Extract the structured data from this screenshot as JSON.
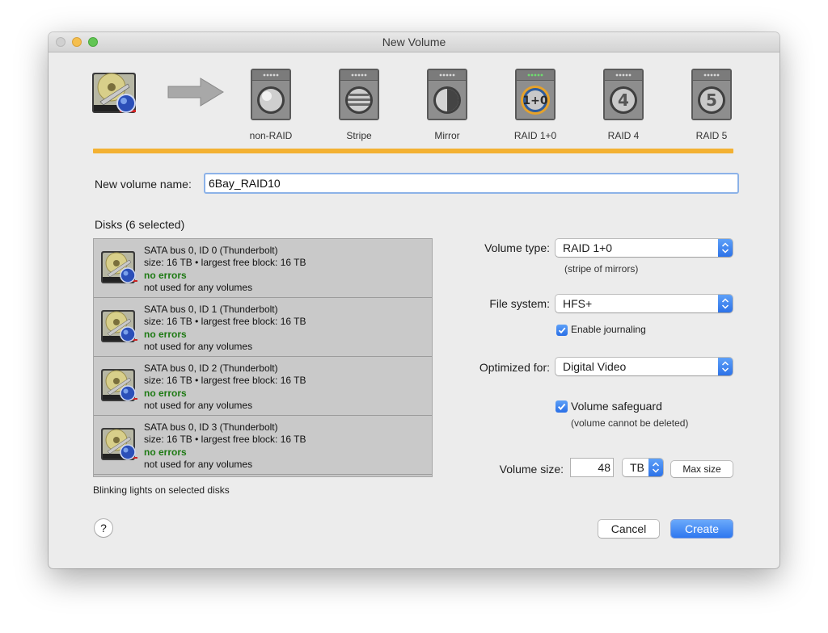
{
  "window": {
    "title": "New Volume"
  },
  "raid_options": [
    {
      "label": "non-RAID",
      "icon": "sphere-plain"
    },
    {
      "label": "Stripe",
      "icon": "sphere-striped"
    },
    {
      "label": "Mirror",
      "icon": "sphere-half"
    },
    {
      "label": "RAID 1+0",
      "icon": "sphere-1+0",
      "glyph": "1+0",
      "selected": true
    },
    {
      "label": "RAID 4",
      "icon": "sphere-4",
      "glyph": "4"
    },
    {
      "label": "RAID 5",
      "icon": "sphere-5",
      "glyph": "5"
    }
  ],
  "volume_name": {
    "label": "New volume name:",
    "value": "6Bay_RAID10"
  },
  "disks": {
    "header": "Disks (6 selected)",
    "rows": [
      {
        "title": "SATA bus 0, ID 0 (Thunderbolt)",
        "size": "size: 16 TB • largest free block: 16 TB",
        "status": "no errors",
        "usage": "not used for any volumes"
      },
      {
        "title": "SATA bus 0, ID 1 (Thunderbolt)",
        "size": "size: 16 TB • largest free block: 16 TB",
        "status": "no errors",
        "usage": "not used for any volumes"
      },
      {
        "title": "SATA bus 0, ID 2 (Thunderbolt)",
        "size": "size: 16 TB • largest free block: 16 TB",
        "status": "no errors",
        "usage": "not used for any volumes"
      },
      {
        "title": "SATA bus 0, ID 3 (Thunderbolt)",
        "size": "size: 16 TB • largest free block: 16 TB",
        "status": "no errors",
        "usage": "not used for any volumes"
      }
    ],
    "footer": "Blinking lights on selected disks"
  },
  "volume_type": {
    "label": "Volume type:",
    "value": "RAID 1+0",
    "note": "(stripe of mirrors)"
  },
  "file_system": {
    "label": "File system:",
    "value": "HFS+",
    "journaling_label": "Enable journaling",
    "journaling_checked": true
  },
  "optimized_for": {
    "label": "Optimized for:",
    "value": "Digital Video"
  },
  "safeguard": {
    "label": "Volume safeguard",
    "note": "(volume cannot be deleted)",
    "checked": true
  },
  "volume_size": {
    "label": "Volume size:",
    "value": "48",
    "unit": "TB",
    "max_label": "Max size"
  },
  "buttons": {
    "cancel": "Cancel",
    "create": "Create",
    "help": "?"
  },
  "colors": {
    "accent": "#2e77ef",
    "progress": "#f3b132",
    "ok_text": "#1e7a14",
    "selected_ring": "#e6a22a"
  }
}
